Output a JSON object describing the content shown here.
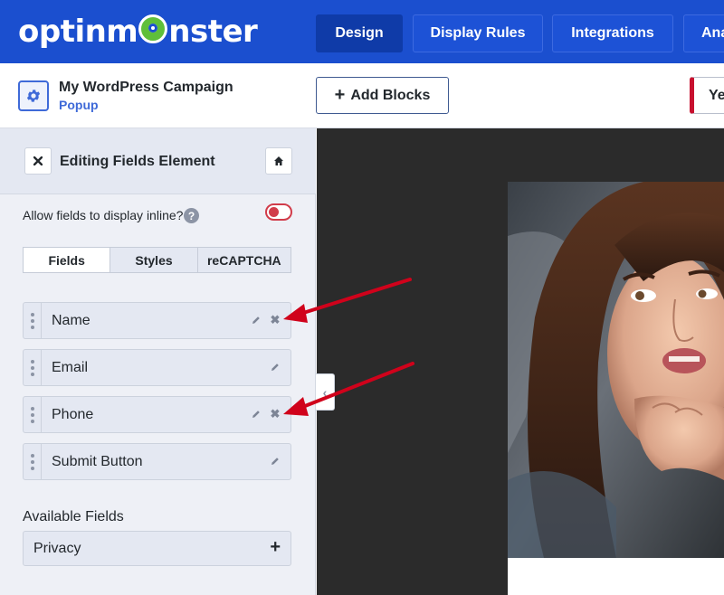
{
  "nav": {
    "logo_before": "optinm",
    "logo_after": "nster",
    "items": [
      {
        "label": "Design",
        "active": true
      },
      {
        "label": "Display Rules",
        "active": false
      },
      {
        "label": "Integrations",
        "active": false
      },
      {
        "label": "Ana",
        "active": false
      }
    ]
  },
  "campaign": {
    "title": "My WordPress Campaign",
    "type": "Popup",
    "add_blocks_label": "Add Blocks",
    "right_button_label": "Ye"
  },
  "sidebar": {
    "title": "Editing Fields Element",
    "inline_label": "Allow fields to display inline?",
    "help_glyph": "?",
    "inline_enabled": false,
    "tabs": [
      {
        "label": "Fields",
        "active": true
      },
      {
        "label": "Styles",
        "active": false
      },
      {
        "label": "reCAPTCHA",
        "active": false
      }
    ],
    "fields": [
      {
        "label": "Name",
        "removable": true
      },
      {
        "label": "Email",
        "removable": false
      },
      {
        "label": "Phone",
        "removable": true
      },
      {
        "label": "Submit Button",
        "removable": false
      }
    ],
    "available_title": "Available Fields",
    "available": [
      {
        "label": "Privacy"
      }
    ]
  },
  "colors": {
    "brand_blue": "#1b4fcf",
    "accent_blue": "#3f6ad8",
    "arrow_red": "#d0021b",
    "toggle_red": "#d13c4a"
  },
  "icons": {
    "close": "close-icon",
    "home": "home-icon",
    "gear": "gear-icon",
    "edit": "pencil-icon",
    "remove": "remove-icon",
    "add": "plus-icon",
    "collapse": "chevron-left-icon"
  }
}
